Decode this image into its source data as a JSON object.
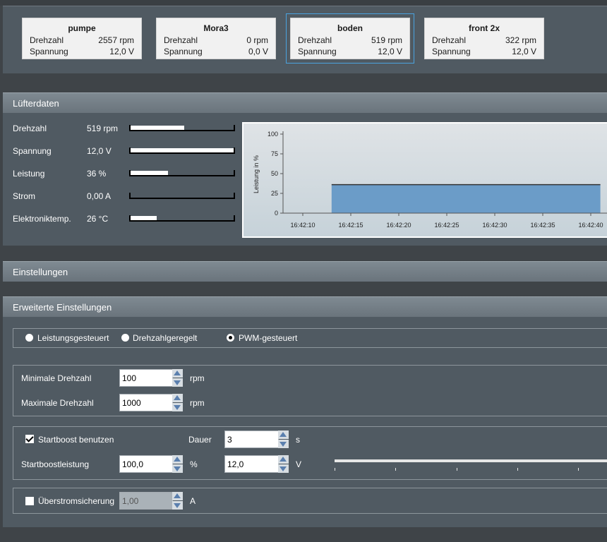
{
  "fans": [
    {
      "name": "pumpe",
      "speed_label": "Drehzahl",
      "speed": "2557 rpm",
      "voltage_label": "Spannung",
      "voltage": "12,0 V",
      "selected": false
    },
    {
      "name": "Mora3",
      "speed_label": "Drehzahl",
      "speed": "0 rpm",
      "voltage_label": "Spannung",
      "voltage": "0,0 V",
      "selected": false
    },
    {
      "name": "boden",
      "speed_label": "Drehzahl",
      "speed": "519 rpm",
      "voltage_label": "Spannung",
      "voltage": "12,0 V",
      "selected": true
    },
    {
      "name": "front 2x",
      "speed_label": "Drehzahl",
      "speed": "322 rpm",
      "voltage_label": "Spannung",
      "voltage": "12,0 V",
      "selected": false
    }
  ],
  "fan_data": {
    "title": "Lüfterdaten",
    "rows": [
      {
        "label": "Drehzahl",
        "value": "519 rpm",
        "level": 0.52
      },
      {
        "label": "Spannung",
        "value": "12,0 V",
        "level": 1.0
      },
      {
        "label": "Leistung",
        "value": "36 %",
        "level": 0.36
      },
      {
        "label": "Strom",
        "value": "0,00 A",
        "level": 0.0
      },
      {
        "label": "Elektroniktemp.",
        "value": "26 °C",
        "level": 0.25
      }
    ]
  },
  "chart_data": {
    "type": "area",
    "ylabel": "Leistung in %",
    "ylim": [
      0,
      100
    ],
    "yticks": [
      "0",
      "25",
      "50",
      "75",
      "100"
    ],
    "xticks": [
      "16:42:10",
      "16:42:15",
      "16:42:20",
      "16:42:25",
      "16:42:30",
      "16:42:35",
      "16:42:40"
    ],
    "series": [
      {
        "x": [
          "16:42:13",
          "16:42:41"
        ],
        "y": [
          36,
          36
        ],
        "color": "#6b9cc8"
      }
    ]
  },
  "settings": {
    "title": "Einstellungen"
  },
  "advanced": {
    "title": "Erweiterte Einstellungen",
    "modes": [
      {
        "label": "Leistungsgesteuert",
        "checked": false
      },
      {
        "label": "Drehzahlgeregelt",
        "checked": false
      },
      {
        "label": "PWM-gesteuert",
        "checked": true
      }
    ],
    "min_speed": {
      "label": "Minimale Drehzahl",
      "value": "100",
      "unit": "rpm"
    },
    "max_speed": {
      "label": "Maximale Drehzahl",
      "value": "1000",
      "unit": "rpm"
    },
    "startboost": {
      "label": "Startboost benutzen",
      "checked": true,
      "duration_label": "Dauer",
      "duration": "3",
      "duration_unit": "s",
      "power_label": "Startboostleistung",
      "power": "100,0",
      "power_unit": "%",
      "voltage": "12,0",
      "voltage_unit": "V"
    },
    "overcurrent": {
      "label": "Überstromsicherung",
      "checked": false,
      "value": "1,00",
      "unit": "A"
    }
  },
  "colors": {
    "accent": "#4aa3df",
    "chart_fill": "#6b9cc8"
  }
}
